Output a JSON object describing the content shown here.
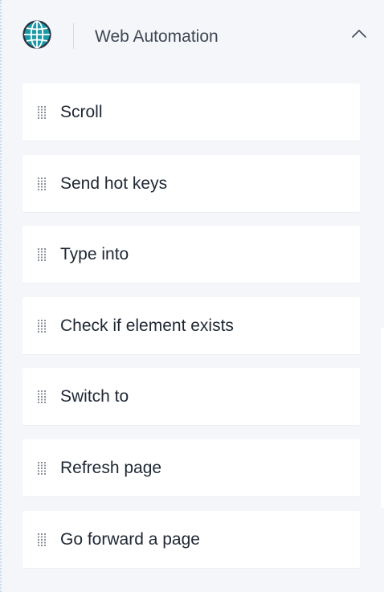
{
  "section": {
    "title": "Web Automation",
    "icon": "globe-icon",
    "toggle_icon": "chevron-up-icon",
    "accent_color": "#1a9aa6"
  },
  "items": [
    {
      "label": "Scroll"
    },
    {
      "label": "Send hot keys"
    },
    {
      "label": "Type into"
    },
    {
      "label": "Check if element exists"
    },
    {
      "label": "Switch to"
    },
    {
      "label": "Refresh page"
    },
    {
      "label": "Go forward a page"
    }
  ]
}
